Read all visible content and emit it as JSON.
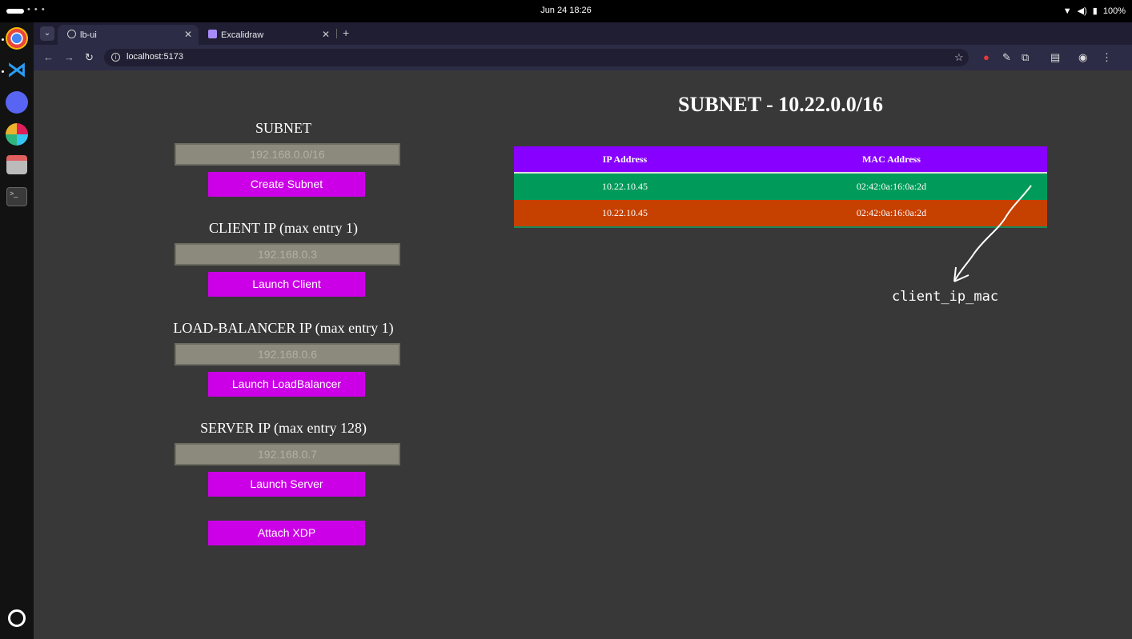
{
  "system": {
    "clock": "Jun 24  18:26",
    "battery": "100%"
  },
  "dock": {
    "apps": [
      {
        "name": "chrome",
        "color": "#e8453c"
      },
      {
        "name": "vscode",
        "color": "#2a9df4"
      },
      {
        "name": "discord",
        "color": "#5865f2"
      },
      {
        "name": "slack",
        "color": "#ffffff"
      },
      {
        "name": "files",
        "color": "#e06060"
      },
      {
        "name": "terminal",
        "color": "#444444"
      }
    ]
  },
  "browser": {
    "tabs": [
      {
        "label": "lb-ui",
        "active": true
      },
      {
        "label": "Excalidraw",
        "active": false
      }
    ],
    "url": "localhost:5173"
  },
  "form": {
    "subnet_label": "SUBNET",
    "subnet_placeholder": "192.168.0.0/16",
    "create_subnet": "Create Subnet",
    "client_label": "CLIENT IP (max entry 1)",
    "client_placeholder": "192.168.0.3",
    "launch_client": "Launch Client",
    "lb_label": "LOAD-BALANCER IP (max entry 1)",
    "lb_placeholder": "192.168.0.6",
    "launch_lb": "Launch LoadBalancer",
    "server_label": "SERVER IP (max entry 128)",
    "server_placeholder": "192.168.0.7",
    "launch_server": "Launch Server",
    "attach_xdp": "Attach XDP"
  },
  "subnet_panel": {
    "title": "SUBNET - 10.22.0.0/16",
    "columns": [
      "IP Address",
      "MAC Address"
    ],
    "rows": [
      {
        "ip": "10.22.10.45",
        "mac": "02:42:0a:16:0a:2d",
        "color": "#009b5a"
      },
      {
        "ip": "10.22.10.45",
        "mac": "02:42:0a:16:0a:2d",
        "color": "#c64000"
      }
    ]
  },
  "annotation": {
    "label": "client_ip_mac"
  },
  "colors": {
    "page_bg": "#383838",
    "button": "#cc00e6",
    "table_header": "#8800ff",
    "input_bg": "#8b8a7c"
  }
}
